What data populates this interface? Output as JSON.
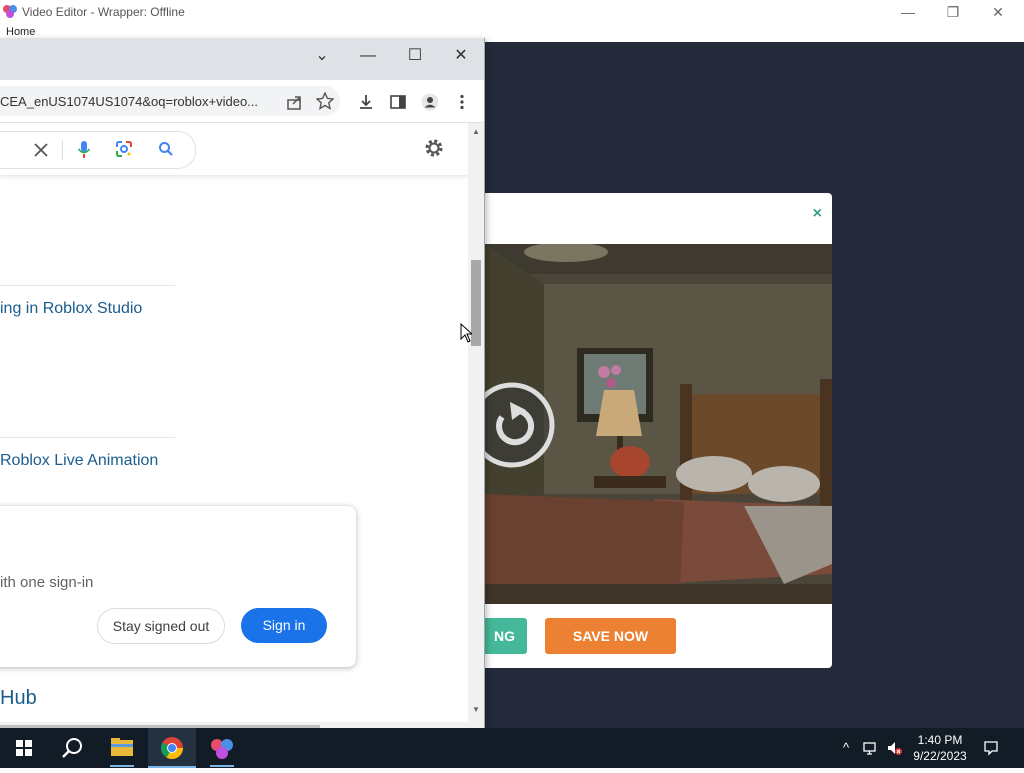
{
  "editor": {
    "title": "Video Editor - Wrapper: Offline",
    "menu_home": "Home"
  },
  "modal": {
    "close": "×",
    "green_button": "NG",
    "orange_button": "SAVE NOW"
  },
  "chrome": {
    "url": "CEA_enUS1074US1074&oq=roblox+video...",
    "results": [
      {
        "text": "ing in Roblox Studio"
      },
      {
        "text": "Roblox Live Animation"
      }
    ],
    "signin_card": {
      "subtitle": "ith one sign-in",
      "stay_button": "Stay signed out",
      "signin_button": "Sign in"
    },
    "hub_link": "Hub"
  },
  "taskbar": {
    "time": "1:40 PM",
    "date": "9/22/2023"
  },
  "colors": {
    "stage_bg": "#252a3a",
    "modal_green": "#46b89a",
    "modal_orange": "#ec8133",
    "link_blue": "#1a5d8f",
    "google_blue": "#1a73e8",
    "taskbar": "#121c26"
  }
}
